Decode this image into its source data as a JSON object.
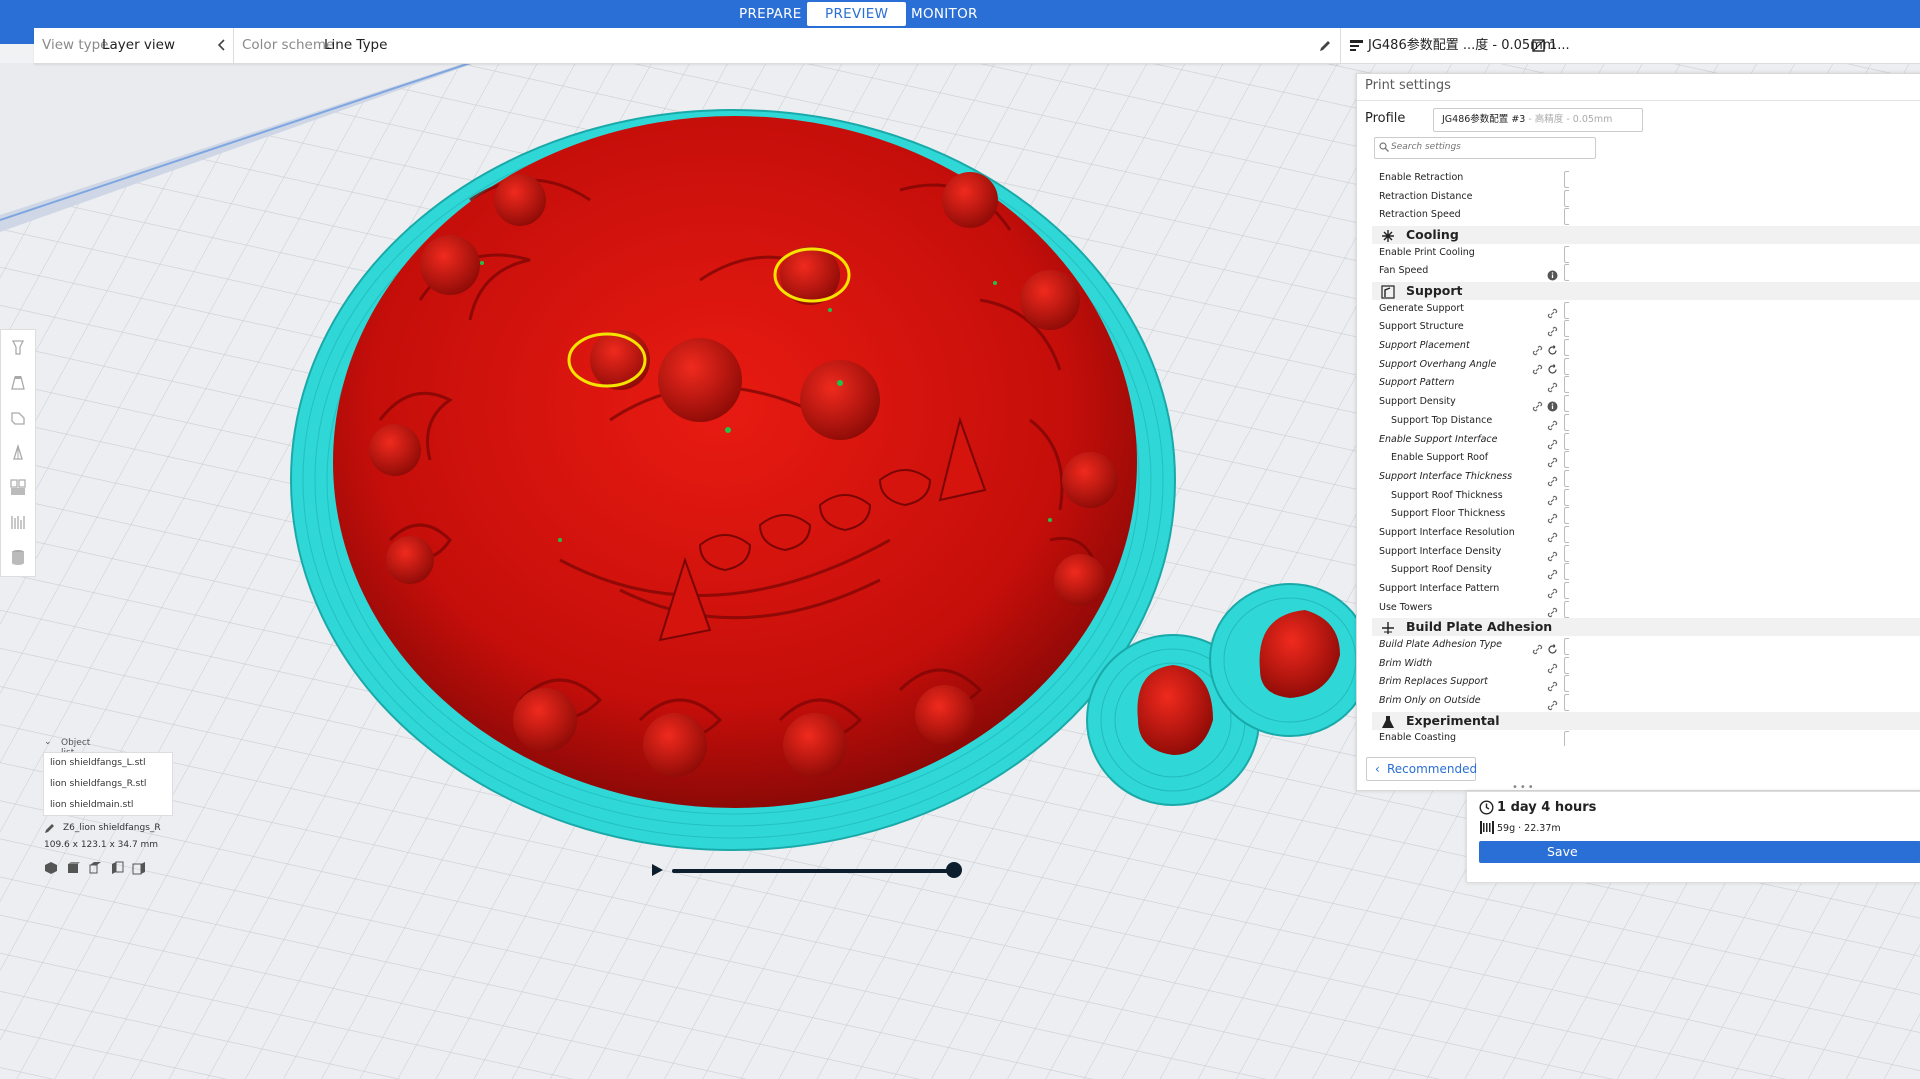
{
  "stages": {
    "prepare": "PREPARE",
    "preview": "PREVIEW",
    "monitor": "MONITOR"
  },
  "header": {
    "view_type_label": "View type",
    "view_type_value": "Layer view",
    "color_scheme_label": "Color scheme",
    "color_scheme_value": "Line Type"
  },
  "printer_bar": {
    "profile_summary": "JG486参数配置 ...度 - 0.05mm",
    "extruder_summary": "1..."
  },
  "print_settings": {
    "title": "Print settings",
    "profile_label": "Profile",
    "profile_value": "JG486参数配置 #3",
    "profile_suffix": " - 高精度 - 0.05mm",
    "search_placeholder": "Search settings",
    "rows": [
      {
        "label": "Enable Retraction"
      },
      {
        "label": "Retraction Distance"
      },
      {
        "label": "Retraction Speed"
      },
      {
        "section": "Cooling",
        "icon": "fan-icon"
      },
      {
        "label": "Enable Print Cooling"
      },
      {
        "label": "Fan Speed"
      },
      {
        "section": "Support",
        "icon": "support-icon"
      },
      {
        "label": "Generate Support"
      },
      {
        "label": "Support Structure"
      },
      {
        "label": "Support Placement"
      },
      {
        "label": "Support Overhang Angle"
      },
      {
        "label": "Support Pattern"
      },
      {
        "label": "Support Density"
      },
      {
        "label": "Support Top Distance"
      },
      {
        "label": "Enable Support Interface"
      },
      {
        "label": "Enable Support Roof"
      },
      {
        "label": "Support Interface Thickness"
      },
      {
        "label": "Support Roof Thickness"
      },
      {
        "label": "Support Floor Thickness"
      },
      {
        "label": "Support Interface Resolution"
      },
      {
        "label": "Support Interface Density"
      },
      {
        "label": "Support Roof Density"
      },
      {
        "label": "Support Interface Pattern"
      },
      {
        "label": "Use Towers"
      },
      {
        "section": "Build Plate Adhesion",
        "icon": "adhesion-icon"
      },
      {
        "label": "Build Plate Adhesion Type"
      },
      {
        "label": "Brim Width"
      },
      {
        "label": "Brim Replaces Support"
      },
      {
        "label": "Brim Only on Outside"
      },
      {
        "section": "Experimental",
        "icon": "flask-icon"
      },
      {
        "label": "Enable Coasting"
      }
    ],
    "recommended_label": "Recommended"
  },
  "estimate": {
    "time": "1 day 4 hours",
    "material": "59g · 22.37m",
    "save_label": "Save"
  },
  "object_list": {
    "header": "Object list",
    "items": [
      "lion shieldfangs_L.stl",
      "lion shieldfangs_R.stl",
      "lion shieldmain.stl"
    ],
    "selected_name": "Z6_lion shieldfangs_R",
    "dimensions": "109.6 x 123.1 x 34.7 mm"
  },
  "colors": {
    "accent": "#2a6fd5",
    "wall_outer": "#e01010",
    "skirt": "#2fd7d7",
    "support_yellow": "#f5e400",
    "infill_green": "#22c24a"
  }
}
